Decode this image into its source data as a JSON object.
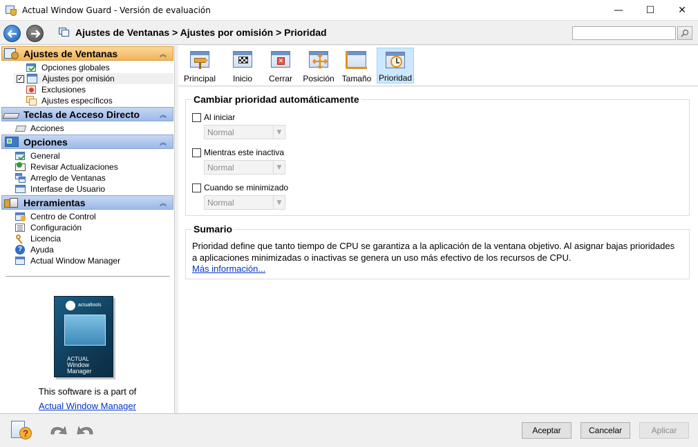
{
  "window": {
    "title": "Actual Window Guard - Versión de evaluación",
    "minimize": "—",
    "maximize": "☐",
    "close": "✕"
  },
  "address": {
    "back_icon": "arrow-left-icon",
    "forward_icon": "arrow-right-icon",
    "breadcrumb": "Ajustes de Ventanas > Ajustes por omisión > Prioridad",
    "search_value": ""
  },
  "sidebar": {
    "groups": [
      {
        "title": "Ajustes de Ventanas",
        "active": true,
        "items": [
          {
            "label": "Opciones globales",
            "checked": false
          },
          {
            "label": "Ajustes por omisión",
            "checked": true,
            "selected": true
          },
          {
            "label": "Exclusiones",
            "checked": false
          },
          {
            "label": "Ajustes específicos",
            "checked": false
          }
        ]
      },
      {
        "title": "Teclas de Acceso Directo",
        "items": [
          {
            "label": "Acciones"
          }
        ]
      },
      {
        "title": "Opciones",
        "items": [
          {
            "label": "General"
          },
          {
            "label": "Revisar Actualizaciones"
          },
          {
            "label": "Arreglo de Ventanas"
          },
          {
            "label": "Interfase de Usuario"
          }
        ]
      },
      {
        "title": "Herramientas",
        "items": [
          {
            "label": "Centro de Control"
          },
          {
            "label": "Configuración"
          },
          {
            "label": "Licencia"
          },
          {
            "label": "Ayuda"
          },
          {
            "label": "Actual Window Manager"
          }
        ]
      }
    ],
    "promo": {
      "box_brand": "actualtools",
      "box_title_line1": "ACTUAL",
      "box_title_line2": "Window Manager",
      "text": "This software is a part of",
      "link": "Actual Window Manager"
    }
  },
  "toolbar": {
    "tabs": [
      {
        "label": "Principal",
        "active": false
      },
      {
        "label": "Inicio",
        "active": false
      },
      {
        "label": "Cerrar",
        "active": false
      },
      {
        "label": "Posición",
        "active": false
      },
      {
        "label": "Tamaño",
        "active": false
      },
      {
        "label": "Prioridad",
        "active": true
      }
    ]
  },
  "priority": {
    "section_title": "Cambiar prioridad automáticamente",
    "options": [
      {
        "label": "Al iniciar",
        "checked": false,
        "value": "Normal"
      },
      {
        "label": "Mientras este inactiva",
        "checked": false,
        "value": "Normal"
      },
      {
        "label": "Cuando se minimizado",
        "checked": false,
        "value": "Normal"
      }
    ]
  },
  "summary": {
    "title": "Sumario",
    "text": "Prioridad define que tanto tiempo de CPU se garantiza a la aplicación de la ventana objetivo. Al asignar bajas prioridades a aplicaciones minimizadas o inactivas se genera un uso más efectivo de los recursos de CPU.",
    "link": "Más información..."
  },
  "buttons": {
    "accept": "Aceptar",
    "cancel": "Cancelar",
    "apply": "Aplicar"
  }
}
